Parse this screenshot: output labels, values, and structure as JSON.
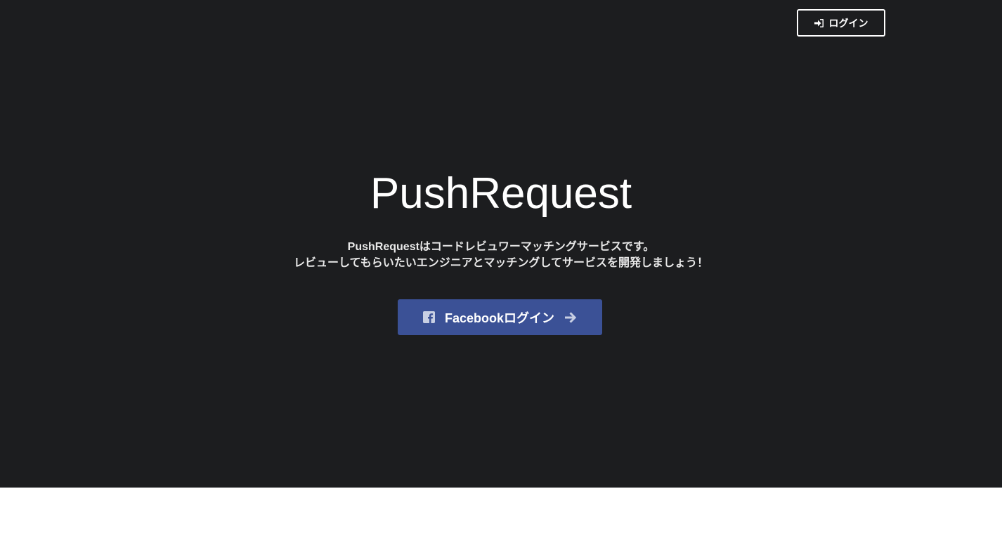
{
  "header": {
    "login_label": "ログイン",
    "login_icon": "sign-in-icon"
  },
  "hero": {
    "title": "PushRequest",
    "description_line1": "PushRequestはコードレビュワーマッチングサービスです。",
    "description_line2": "レビューしてもらいたいエンジニアとマッチングしてサービスを開発しましょう！",
    "facebook_login_label": "Facebookログイン",
    "facebook_icon": "facebook-square-icon",
    "arrow_icon": "arrow-right-icon"
  },
  "colors": {
    "hero_background": "#1c1d1f",
    "facebook_button": "#3b5196",
    "page_background": "#ffffff"
  }
}
